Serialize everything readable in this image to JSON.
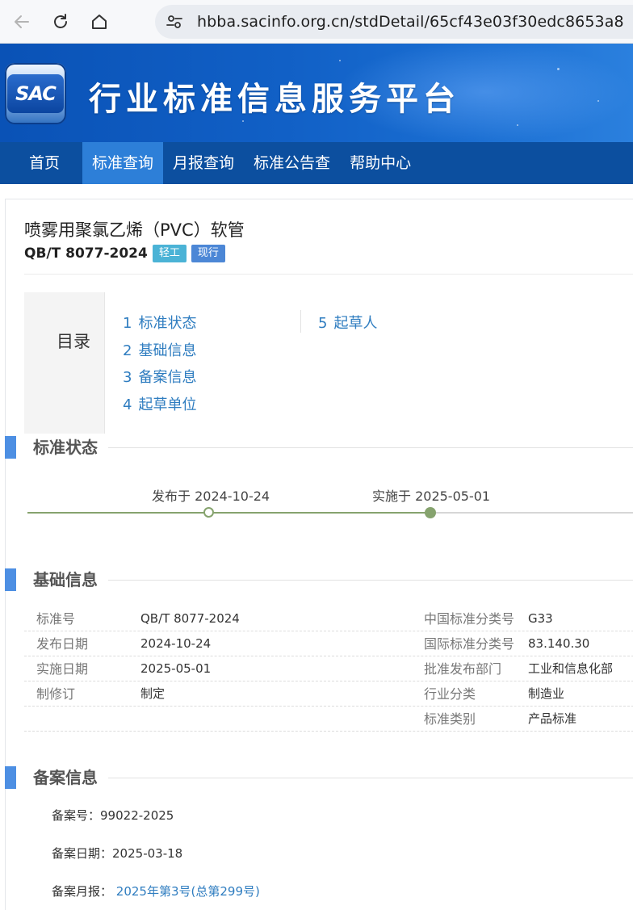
{
  "browser": {
    "url": "hbba.sacinfo.org.cn/stdDetail/65cf43e03f30edc8653a8"
  },
  "banner": {
    "logo_text": "SAC",
    "site_title": "行业标准信息服务平台"
  },
  "nav": {
    "items": [
      "首页",
      "标准查询",
      "月报查询",
      "标准公告查",
      "帮助中心"
    ],
    "active_index": 1
  },
  "standard": {
    "title": "喷雾用聚氯乙烯（PVC）软管",
    "code": "QB/T 8077-2024",
    "category_tag": "轻工",
    "status_tag": "现行"
  },
  "toc": {
    "title": "目录",
    "col1": [
      {
        "num": "1",
        "label": "标准状态"
      },
      {
        "num": "2",
        "label": "基础信息"
      },
      {
        "num": "3",
        "label": "备案信息"
      },
      {
        "num": "4",
        "label": "起草单位"
      }
    ],
    "col2": [
      {
        "num": "5",
        "label": "起草人"
      }
    ]
  },
  "sections": {
    "status": "标准状态",
    "basic": "基础信息",
    "filing": "备案信息"
  },
  "timeline": {
    "published": "发布于 2024-10-24",
    "implemented": "实施于 2025-05-01"
  },
  "basic_info": {
    "rows": [
      {
        "l1": "标准号",
        "v1": "QB/T 8077-2024",
        "l2": "中国标准分类号",
        "v2": "G33"
      },
      {
        "l1": "发布日期",
        "v1": "2024-10-24",
        "l2": "国际标准分类号",
        "v2": "83.140.30"
      },
      {
        "l1": "实施日期",
        "v1": "2025-05-01",
        "l2": "批准发布部门",
        "v2": "工业和信息化部"
      },
      {
        "l1": "制修订",
        "v1": "制定",
        "l2": "行业分类",
        "v2": "制造业"
      },
      {
        "l1": "",
        "v1": "",
        "l2": "标准类别",
        "v2": "产品标准"
      }
    ]
  },
  "filing": {
    "number_label": "备案号：",
    "number": "99022-2025",
    "date_label": "备案日期：",
    "date": "2025-03-18",
    "monthly_label": "备案月报：",
    "monthly_link": "2025年第3号(总第299号)"
  }
}
